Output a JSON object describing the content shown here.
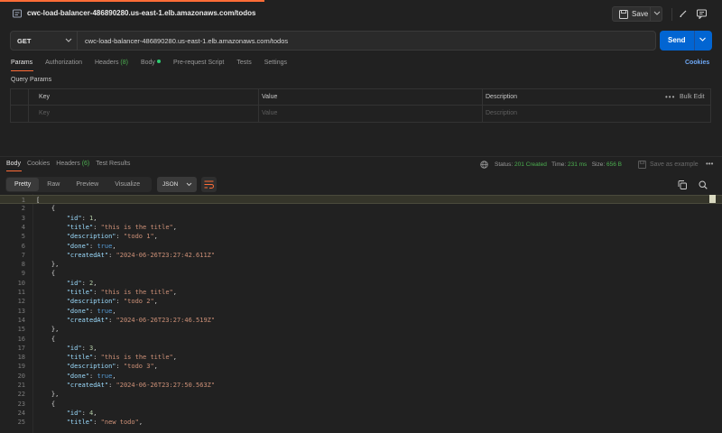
{
  "header": {
    "request_title": "cwc-load-balancer-486890280.us-east-1.elb.amazonaws.com/todos",
    "save_label": "Save"
  },
  "request": {
    "method": "GET",
    "url": "cwc-load-balancer-486890280.us-east-1.elb.amazonaws.com/todos",
    "send_label": "Send",
    "tabs": [
      {
        "label": "Params"
      },
      {
        "label": "Authorization"
      },
      {
        "label": "Headers",
        "count": "(8)"
      },
      {
        "label": "Body"
      },
      {
        "label": "Pre-request Script"
      },
      {
        "label": "Tests"
      },
      {
        "label": "Settings"
      }
    ],
    "cookies_label": "Cookies",
    "query_params_title": "Query Params",
    "table": {
      "columns": [
        "Key",
        "Value",
        "Description"
      ],
      "placeholders": [
        "Key",
        "Value",
        "Description"
      ],
      "bulk_edit": "Bulk Edit",
      "more": "•••"
    }
  },
  "response": {
    "tabs": [
      {
        "label": "Body"
      },
      {
        "label": "Cookies"
      },
      {
        "label": "Headers",
        "count": "(6)"
      },
      {
        "label": "Test Results"
      }
    ],
    "status_label": "Status:",
    "status_value": "201 Created",
    "time_label": "Time:",
    "time_value": "231 ms",
    "size_label": "Size:",
    "size_value": "656 B",
    "save_example": "Save as example",
    "more": "•••",
    "views": [
      "Pretty",
      "Raw",
      "Preview",
      "Visualize"
    ],
    "format": "JSON",
    "lines": [
      {
        "n": "1",
        "t": "["
      },
      {
        "n": "2",
        "t": "    {"
      },
      {
        "n": "3",
        "t": "        \"id\": 1,"
      },
      {
        "n": "4",
        "t": "        \"title\": \"this is the title\","
      },
      {
        "n": "5",
        "t": "        \"description\": \"todo 1\","
      },
      {
        "n": "6",
        "t": "        \"done\": true,"
      },
      {
        "n": "7",
        "t": "        \"createdAt\": \"2024-06-26T23:27:42.611Z\""
      },
      {
        "n": "8",
        "t": "    },"
      },
      {
        "n": "9",
        "t": "    {"
      },
      {
        "n": "10",
        "t": "        \"id\": 2,"
      },
      {
        "n": "11",
        "t": "        \"title\": \"this is the title\","
      },
      {
        "n": "12",
        "t": "        \"description\": \"todo 2\","
      },
      {
        "n": "13",
        "t": "        \"done\": true,"
      },
      {
        "n": "14",
        "t": "        \"createdAt\": \"2024-06-26T23:27:46.519Z\""
      },
      {
        "n": "15",
        "t": "    },"
      },
      {
        "n": "16",
        "t": "    {"
      },
      {
        "n": "17",
        "t": "        \"id\": 3,"
      },
      {
        "n": "18",
        "t": "        \"title\": \"this is the title\","
      },
      {
        "n": "19",
        "t": "        \"description\": \"todo 3\","
      },
      {
        "n": "20",
        "t": "        \"done\": true,"
      },
      {
        "n": "21",
        "t": "        \"createdAt\": \"2024-06-26T23:27:50.563Z\""
      },
      {
        "n": "22",
        "t": "    },"
      },
      {
        "n": "23",
        "t": "    {"
      },
      {
        "n": "24",
        "t": "        \"id\": 4,"
      },
      {
        "n": "25",
        "t": "        \"title\": \"new todo\","
      }
    ]
  },
  "colors": {
    "accent": "#ff6c37",
    "send": "#0265d2",
    "status_ok": "#4caf50",
    "link": "#6ea8f5"
  }
}
